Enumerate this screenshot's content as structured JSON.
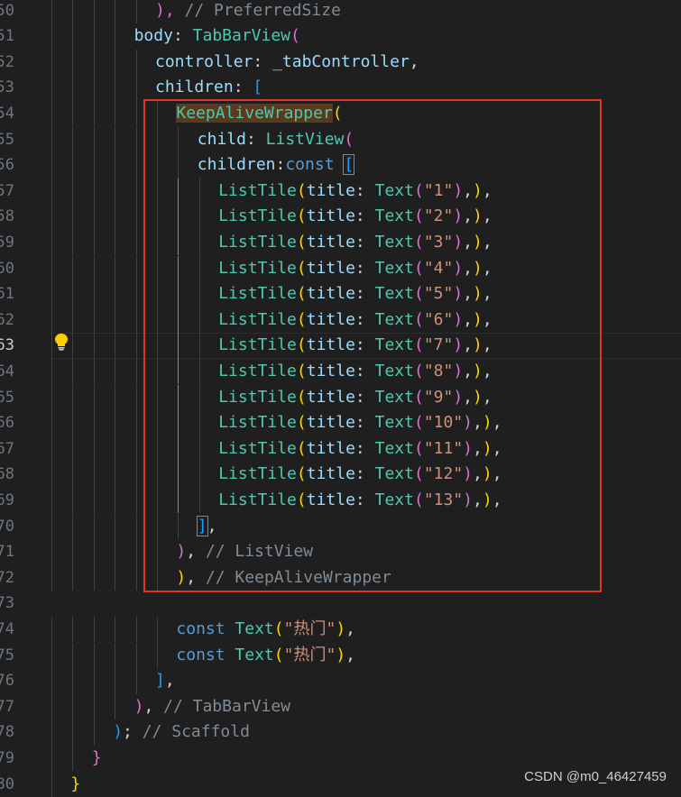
{
  "editor": {
    "current_line": "63",
    "lines": [
      {
        "no": "50",
        "indent": 5,
        "tokens": [
          {
            "t": "), ",
            "c": "b2"
          },
          {
            "t": "// PreferredSize",
            "c": "t-com"
          }
        ]
      },
      {
        "no": "51",
        "indent": 4,
        "tokens": [
          {
            "t": "body",
            "c": "t-prop"
          },
          {
            "t": ": ",
            "c": "t-p"
          },
          {
            "t": "TabBarView",
            "c": "t-cls"
          },
          {
            "t": "(",
            "c": "b2"
          }
        ]
      },
      {
        "no": "52",
        "indent": 5,
        "tokens": [
          {
            "t": "controller",
            "c": "t-prop"
          },
          {
            "t": ": ",
            "c": "t-p"
          },
          {
            "t": "_tabController",
            "c": "t-prop"
          },
          {
            "t": ",",
            "c": "t-p"
          }
        ]
      },
      {
        "no": "53",
        "indent": 5,
        "tokens": [
          {
            "t": "children",
            "c": "t-prop"
          },
          {
            "t": ": ",
            "c": "t-p"
          },
          {
            "t": "[",
            "c": "b3"
          }
        ]
      },
      {
        "no": "54",
        "indent": 6,
        "tokens": [
          {
            "t": "KeepAliveWrapper",
            "c": "t-cls hl-word"
          },
          {
            "t": "(",
            "c": "b1"
          }
        ]
      },
      {
        "no": "55",
        "indent": 7,
        "tokens": [
          {
            "t": "child",
            "c": "t-prop"
          },
          {
            "t": ": ",
            "c": "t-p"
          },
          {
            "t": "ListView",
            "c": "t-cls"
          },
          {
            "t": "(",
            "c": "b2"
          }
        ]
      },
      {
        "no": "56",
        "indent": 7,
        "tokens": [
          {
            "t": "children",
            "c": "t-prop"
          },
          {
            "t": ":",
            "c": "t-p"
          },
          {
            "t": "const",
            "c": "t-kw"
          },
          {
            "t": " ",
            "c": "t-p"
          },
          {
            "t": "[",
            "c": "b3 box-br"
          }
        ]
      },
      {
        "no": "57",
        "indent": 8,
        "tokens": [
          {
            "t": "ListTile",
            "c": "t-cls"
          },
          {
            "t": "(",
            "c": "b1"
          },
          {
            "t": "title",
            "c": "t-prop"
          },
          {
            "t": ": ",
            "c": "t-p"
          },
          {
            "t": "Text",
            "c": "t-cls"
          },
          {
            "t": "(",
            "c": "b2"
          },
          {
            "t": "\"1\"",
            "c": "t-str"
          },
          {
            "t": ")",
            "c": "b2"
          },
          {
            "t": ",",
            "c": "t-p"
          },
          {
            "t": ")",
            "c": "b1"
          },
          {
            "t": ",",
            "c": "t-p"
          }
        ]
      },
      {
        "no": "58",
        "indent": 8,
        "tokens": [
          {
            "t": "ListTile",
            "c": "t-cls"
          },
          {
            "t": "(",
            "c": "b1"
          },
          {
            "t": "title",
            "c": "t-prop"
          },
          {
            "t": ": ",
            "c": "t-p"
          },
          {
            "t": "Text",
            "c": "t-cls"
          },
          {
            "t": "(",
            "c": "b2"
          },
          {
            "t": "\"2\"",
            "c": "t-str"
          },
          {
            "t": ")",
            "c": "b2"
          },
          {
            "t": ",",
            "c": "t-p"
          },
          {
            "t": ")",
            "c": "b1"
          },
          {
            "t": ",",
            "c": "t-p"
          }
        ]
      },
      {
        "no": "59",
        "indent": 8,
        "tokens": [
          {
            "t": "ListTile",
            "c": "t-cls"
          },
          {
            "t": "(",
            "c": "b1"
          },
          {
            "t": "title",
            "c": "t-prop"
          },
          {
            "t": ": ",
            "c": "t-p"
          },
          {
            "t": "Text",
            "c": "t-cls"
          },
          {
            "t": "(",
            "c": "b2"
          },
          {
            "t": "\"3\"",
            "c": "t-str"
          },
          {
            "t": ")",
            "c": "b2"
          },
          {
            "t": ",",
            "c": "t-p"
          },
          {
            "t": ")",
            "c": "b1"
          },
          {
            "t": ",",
            "c": "t-p"
          }
        ]
      },
      {
        "no": "60",
        "indent": 8,
        "tokens": [
          {
            "t": "ListTile",
            "c": "t-cls"
          },
          {
            "t": "(",
            "c": "b1"
          },
          {
            "t": "title",
            "c": "t-prop"
          },
          {
            "t": ": ",
            "c": "t-p"
          },
          {
            "t": "Text",
            "c": "t-cls"
          },
          {
            "t": "(",
            "c": "b2"
          },
          {
            "t": "\"4\"",
            "c": "t-str"
          },
          {
            "t": ")",
            "c": "b2"
          },
          {
            "t": ",",
            "c": "t-p"
          },
          {
            "t": ")",
            "c": "b1"
          },
          {
            "t": ",",
            "c": "t-p"
          }
        ]
      },
      {
        "no": "61",
        "indent": 8,
        "tokens": [
          {
            "t": "ListTile",
            "c": "t-cls"
          },
          {
            "t": "(",
            "c": "b1"
          },
          {
            "t": "title",
            "c": "t-prop"
          },
          {
            "t": ": ",
            "c": "t-p"
          },
          {
            "t": "Text",
            "c": "t-cls"
          },
          {
            "t": "(",
            "c": "b2"
          },
          {
            "t": "\"5\"",
            "c": "t-str"
          },
          {
            "t": ")",
            "c": "b2"
          },
          {
            "t": ",",
            "c": "t-p"
          },
          {
            "t": ")",
            "c": "b1"
          },
          {
            "t": ",",
            "c": "t-p"
          }
        ]
      },
      {
        "no": "62",
        "indent": 8,
        "tokens": [
          {
            "t": "ListTile",
            "c": "t-cls"
          },
          {
            "t": "(",
            "c": "b1"
          },
          {
            "t": "title",
            "c": "t-prop"
          },
          {
            "t": ": ",
            "c": "t-p"
          },
          {
            "t": "Text",
            "c": "t-cls"
          },
          {
            "t": "(",
            "c": "b2"
          },
          {
            "t": "\"6\"",
            "c": "t-str"
          },
          {
            "t": ")",
            "c": "b2"
          },
          {
            "t": ",",
            "c": "t-p"
          },
          {
            "t": ")",
            "c": "b1"
          },
          {
            "t": ",",
            "c": "t-p"
          }
        ]
      },
      {
        "no": "63",
        "indent": 8,
        "tokens": [
          {
            "t": "ListTile",
            "c": "t-cls"
          },
          {
            "t": "(",
            "c": "b1"
          },
          {
            "t": "title",
            "c": "t-prop"
          },
          {
            "t": ": ",
            "c": "t-p"
          },
          {
            "t": "Text",
            "c": "t-cls"
          },
          {
            "t": "(",
            "c": "b2"
          },
          {
            "t": "\"7\"",
            "c": "t-str"
          },
          {
            "t": ")",
            "c": "b2"
          },
          {
            "t": ",",
            "c": "t-p"
          },
          {
            "t": ")",
            "c": "b1"
          },
          {
            "t": ",",
            "c": "t-p"
          }
        ]
      },
      {
        "no": "64",
        "indent": 8,
        "tokens": [
          {
            "t": "ListTile",
            "c": "t-cls"
          },
          {
            "t": "(",
            "c": "b1"
          },
          {
            "t": "title",
            "c": "t-prop"
          },
          {
            "t": ": ",
            "c": "t-p"
          },
          {
            "t": "Text",
            "c": "t-cls"
          },
          {
            "t": "(",
            "c": "b2"
          },
          {
            "t": "\"8\"",
            "c": "t-str"
          },
          {
            "t": ")",
            "c": "b2"
          },
          {
            "t": ",",
            "c": "t-p"
          },
          {
            "t": ")",
            "c": "b1"
          },
          {
            "t": ",",
            "c": "t-p"
          }
        ]
      },
      {
        "no": "65",
        "indent": 8,
        "tokens": [
          {
            "t": "ListTile",
            "c": "t-cls"
          },
          {
            "t": "(",
            "c": "b1"
          },
          {
            "t": "title",
            "c": "t-prop"
          },
          {
            "t": ": ",
            "c": "t-p"
          },
          {
            "t": "Text",
            "c": "t-cls"
          },
          {
            "t": "(",
            "c": "b2"
          },
          {
            "t": "\"9\"",
            "c": "t-str"
          },
          {
            "t": ")",
            "c": "b2"
          },
          {
            "t": ",",
            "c": "t-p"
          },
          {
            "t": ")",
            "c": "b1"
          },
          {
            "t": ",",
            "c": "t-p"
          }
        ]
      },
      {
        "no": "66",
        "indent": 8,
        "tokens": [
          {
            "t": "ListTile",
            "c": "t-cls"
          },
          {
            "t": "(",
            "c": "b1"
          },
          {
            "t": "title",
            "c": "t-prop"
          },
          {
            "t": ": ",
            "c": "t-p"
          },
          {
            "t": "Text",
            "c": "t-cls"
          },
          {
            "t": "(",
            "c": "b2"
          },
          {
            "t": "\"10\"",
            "c": "t-str"
          },
          {
            "t": ")",
            "c": "b2"
          },
          {
            "t": ",",
            "c": "t-p"
          },
          {
            "t": ")",
            "c": "b1"
          },
          {
            "t": ",",
            "c": "t-p"
          }
        ]
      },
      {
        "no": "67",
        "indent": 8,
        "tokens": [
          {
            "t": "ListTile",
            "c": "t-cls"
          },
          {
            "t": "(",
            "c": "b1"
          },
          {
            "t": "title",
            "c": "t-prop"
          },
          {
            "t": ": ",
            "c": "t-p"
          },
          {
            "t": "Text",
            "c": "t-cls"
          },
          {
            "t": "(",
            "c": "b2"
          },
          {
            "t": "\"11\"",
            "c": "t-str"
          },
          {
            "t": ")",
            "c": "b2"
          },
          {
            "t": ",",
            "c": "t-p"
          },
          {
            "t": ")",
            "c": "b1"
          },
          {
            "t": ",",
            "c": "t-p"
          }
        ]
      },
      {
        "no": "68",
        "indent": 8,
        "tokens": [
          {
            "t": "ListTile",
            "c": "t-cls"
          },
          {
            "t": "(",
            "c": "b1"
          },
          {
            "t": "title",
            "c": "t-prop"
          },
          {
            "t": ": ",
            "c": "t-p"
          },
          {
            "t": "Text",
            "c": "t-cls"
          },
          {
            "t": "(",
            "c": "b2"
          },
          {
            "t": "\"12\"",
            "c": "t-str"
          },
          {
            "t": ")",
            "c": "b2"
          },
          {
            "t": ",",
            "c": "t-p"
          },
          {
            "t": ")",
            "c": "b1"
          },
          {
            "t": ",",
            "c": "t-p"
          }
        ]
      },
      {
        "no": "69",
        "indent": 8,
        "tokens": [
          {
            "t": "ListTile",
            "c": "t-cls"
          },
          {
            "t": "(",
            "c": "b1"
          },
          {
            "t": "title",
            "c": "t-prop"
          },
          {
            "t": ": ",
            "c": "t-p"
          },
          {
            "t": "Text",
            "c": "t-cls"
          },
          {
            "t": "(",
            "c": "b2"
          },
          {
            "t": "\"13\"",
            "c": "t-str"
          },
          {
            "t": ")",
            "c": "b2"
          },
          {
            "t": ",",
            "c": "t-p"
          },
          {
            "t": ")",
            "c": "b1"
          },
          {
            "t": ",",
            "c": "t-p"
          }
        ]
      },
      {
        "no": "70",
        "indent": 7,
        "tokens": [
          {
            "t": "]",
            "c": "b3 box-br"
          },
          {
            "t": ",",
            "c": "t-p"
          }
        ]
      },
      {
        "no": "71",
        "indent": 6,
        "tokens": [
          {
            "t": ")",
            "c": "b2"
          },
          {
            "t": ", ",
            "c": "t-p"
          },
          {
            "t": "// ListView",
            "c": "t-com"
          }
        ]
      },
      {
        "no": "72",
        "indent": 6,
        "tokens": [
          {
            "t": ")",
            "c": "b1"
          },
          {
            "t": ", ",
            "c": "t-p"
          },
          {
            "t": "// KeepAliveWrapper",
            "c": "t-com"
          }
        ]
      },
      {
        "no": "73",
        "indent": 0,
        "tokens": []
      },
      {
        "no": "74",
        "indent": 6,
        "tokens": [
          {
            "t": "const",
            "c": "t-kw"
          },
          {
            "t": " ",
            "c": "t-p"
          },
          {
            "t": "Text",
            "c": "t-cls"
          },
          {
            "t": "(",
            "c": "b1"
          },
          {
            "t": "\"热门\"",
            "c": "t-str"
          },
          {
            "t": ")",
            "c": "b1"
          },
          {
            "t": ",",
            "c": "t-p"
          }
        ]
      },
      {
        "no": "75",
        "indent": 6,
        "tokens": [
          {
            "t": "const",
            "c": "t-kw"
          },
          {
            "t": " ",
            "c": "t-p"
          },
          {
            "t": "Text",
            "c": "t-cls"
          },
          {
            "t": "(",
            "c": "b1"
          },
          {
            "t": "\"热门\"",
            "c": "t-str"
          },
          {
            "t": ")",
            "c": "b1"
          },
          {
            "t": ",",
            "c": "t-p"
          }
        ]
      },
      {
        "no": "76",
        "indent": 5,
        "tokens": [
          {
            "t": "]",
            "c": "b3"
          },
          {
            "t": ",",
            "c": "t-p"
          }
        ]
      },
      {
        "no": "77",
        "indent": 4,
        "tokens": [
          {
            "t": ")",
            "c": "b2"
          },
          {
            "t": ", ",
            "c": "t-p"
          },
          {
            "t": "// TabBarView",
            "c": "t-com"
          }
        ]
      },
      {
        "no": "78",
        "indent": 3,
        "tokens": [
          {
            "t": ")",
            "c": "b3"
          },
          {
            "t": "; ",
            "c": "t-p"
          },
          {
            "t": "// Scaffold",
            "c": "t-com"
          }
        ]
      },
      {
        "no": "79",
        "indent": 2,
        "tokens": [
          {
            "t": "}",
            "c": "b2"
          }
        ]
      },
      {
        "no": "80",
        "indent": 1,
        "tokens": [
          {
            "t": "}",
            "c": "b1"
          }
        ]
      }
    ]
  },
  "watermark": "CSDN @m0_46427459",
  "colors": {
    "background": "#1f1f1f",
    "keyword": "#569cd6",
    "property": "#9cdcfe",
    "class": "#4ec9b0",
    "string": "#ce9178",
    "comment": "#7f8b97",
    "highlight_box": "#e0332a"
  },
  "icons": {
    "lightbulb": "lightbulb-icon"
  }
}
